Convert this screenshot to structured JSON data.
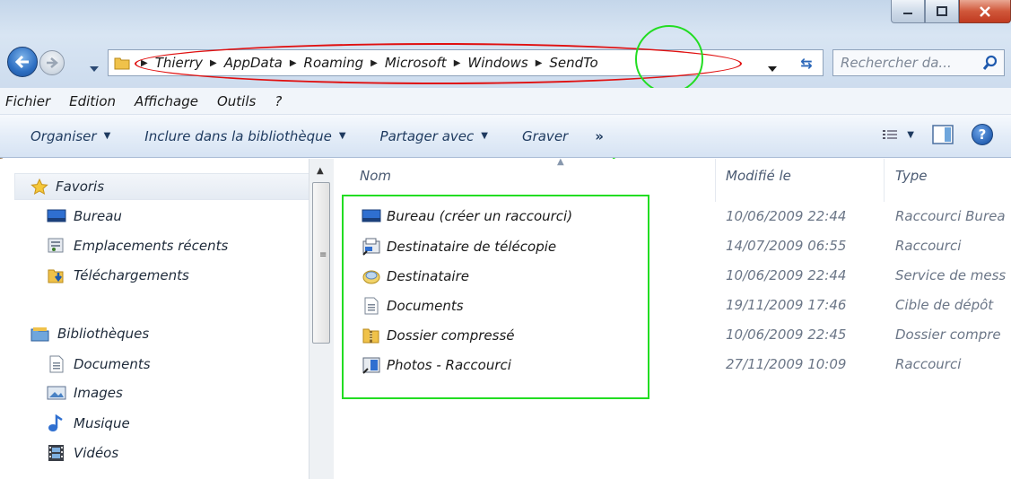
{
  "address": {
    "crumbs": [
      "Thierry",
      "AppData",
      "Roaming",
      "Microsoft",
      "Windows",
      "SendTo"
    ],
    "search_placeholder": "Rechercher da..."
  },
  "menubar": {
    "items": [
      "Fichier",
      "Edition",
      "Affichage",
      "Outils",
      "?"
    ]
  },
  "toolbar": {
    "organize": "Organiser",
    "include": "Inclure dans la bibliothèque",
    "share": "Partager avec",
    "burn": "Graver",
    "more": "»"
  },
  "navpane": {
    "favorites": "Favoris",
    "favorite_items": [
      "Bureau",
      "Emplacements récents",
      "Téléchargements"
    ],
    "libraries": "Bibliothèques",
    "library_items": [
      "Documents",
      "Images",
      "Musique",
      "Vidéos"
    ]
  },
  "filelist": {
    "columns": {
      "name": "Nom",
      "modified": "Modifié le",
      "type": "Type"
    },
    "rows": [
      {
        "name": "Bureau (créer un raccourci)",
        "modified": "10/06/2009 22:44",
        "type": "Raccourci Burea",
        "icon": "desktop-icon"
      },
      {
        "name": "Destinataire de télécopie",
        "modified": "14/07/2009 06:55",
        "type": "Raccourci",
        "icon": "fax-icon"
      },
      {
        "name": "Destinataire",
        "modified": "10/06/2009 22:44",
        "type": "Service de mess",
        "icon": "mail-icon"
      },
      {
        "name": "Documents",
        "modified": "19/11/2009 17:46",
        "type": "Cible de dépôt",
        "icon": "document-icon"
      },
      {
        "name": "Dossier compressé",
        "modified": "10/06/2009 22:45",
        "type": "Dossier compre",
        "icon": "zip-folder-icon"
      },
      {
        "name": "Photos - Raccourci",
        "modified": "27/11/2009 10:09",
        "type": "Raccourci",
        "icon": "photo-shortcut-icon"
      }
    ]
  },
  "colors": {
    "annotation_red": "#e01010",
    "annotation_green": "#22dd22",
    "toolbar_text": "#1e3a5f"
  }
}
